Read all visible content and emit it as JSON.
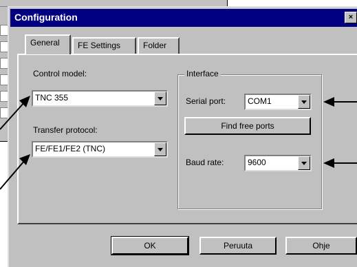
{
  "dialog": {
    "title": "Configuration",
    "close_label": "×"
  },
  "tabs": [
    {
      "label": "General",
      "active": true
    },
    {
      "label": "FE Settings",
      "active": false
    },
    {
      "label": "Folder",
      "active": false
    }
  ],
  "control_model": {
    "label": "Control model:",
    "value": "TNC 355"
  },
  "transfer_protocol": {
    "label": "Transfer protocol:",
    "value": "FE/FE1/FE2 (TNC)"
  },
  "interface": {
    "title": "Interface",
    "serial_port_label": "Serial port:",
    "serial_port_value": "COM1",
    "find_ports_label": "Find free ports",
    "baud_rate_label": "Baud rate:",
    "baud_rate_value": "9600"
  },
  "buttons": {
    "ok": "OK",
    "cancel": "Peruuta",
    "help": "Ohje"
  },
  "colors": {
    "titlebar": "#000080",
    "face": "#c0c0c0",
    "annotation_arrow": "#000000"
  }
}
